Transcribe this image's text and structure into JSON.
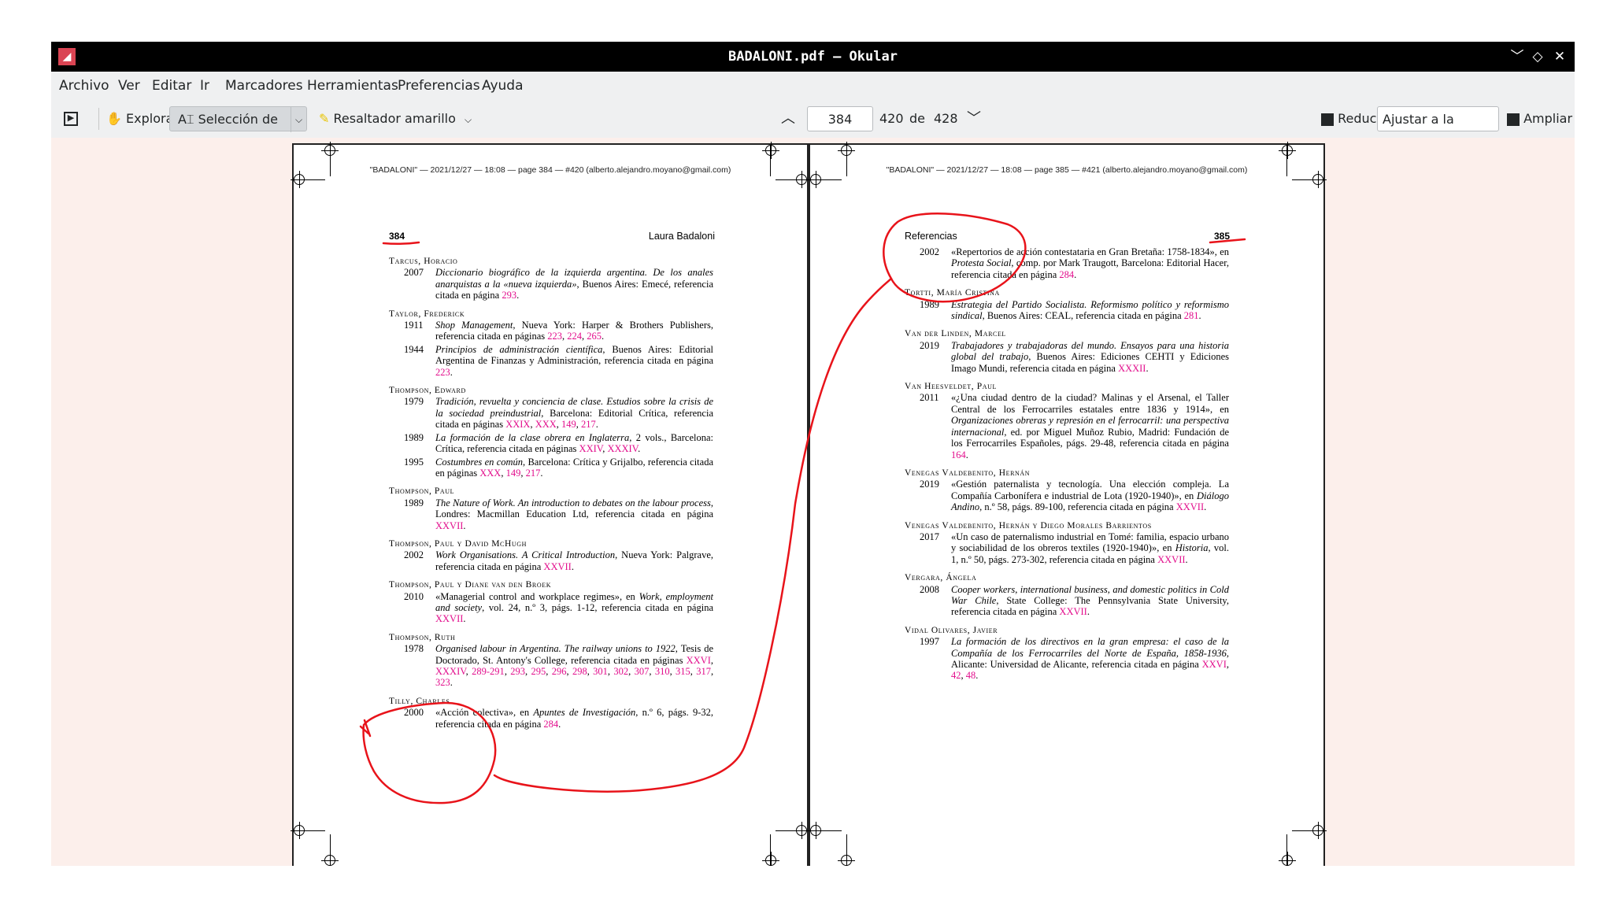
{
  "window": {
    "title": "BADALONI.pdf — Okular",
    "buttons": [
      "﹀",
      "◇",
      "✕"
    ]
  },
  "menu": [
    "Archivo",
    "Ver",
    "Editar",
    "Ir",
    "Marcadores",
    "Herramientas",
    "Preferencias",
    "Ayuda"
  ],
  "toolbar": {
    "explore_label": "Explorar",
    "text_selection_label": "Selección de texto",
    "highlighter_label": "Resaltador amarillo",
    "page_input": "384",
    "page_label": "420",
    "of_label": "de",
    "total_pages": "428",
    "zoom_out_label": "Reducir",
    "zoom_mode": "Ajustar a la página",
    "zoom_in_label": "Ampliar"
  },
  "left_page": {
    "header": "\"BADALONI\" — 2021/12/27 — 18:08 — page 384 — #420 (alberto.alejandro.moyano@gmail.com)",
    "number": "384",
    "running_head": "Laura Badaloni"
  },
  "right_page": {
    "header": "\"BADALONI\" — 2021/12/27 — 18:08 — page 385 — #421 (alberto.alejandro.moyano@gmail.com)",
    "number": "385",
    "running_head": "Referencias"
  },
  "colors": {
    "link": "#e20d8c",
    "annotation": "#e8131a",
    "titlebar": "#000000",
    "viewport": "#fcefeb"
  }
}
